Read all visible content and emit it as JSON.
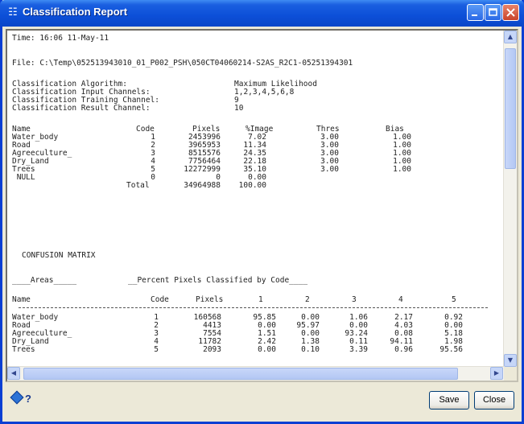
{
  "window": {
    "title": "Classification Report",
    "icon": "report-app-icon",
    "controls": [
      "minimize-icon",
      "maximize-icon",
      "close-icon"
    ]
  },
  "report": {
    "time_line": "Time: 16:06 11-May-11",
    "file_line": "File: C:\\Temp\\052513943010_01_P002_PSH\\050CT04060214-S2AS_R2C1-05251394301",
    "info": [
      {
        "label": "Classification Algorithm:",
        "value": "Maximum Likelihood"
      },
      {
        "label": "Classification Input Channels:",
        "value": "1,2,3,4,5,6,8"
      },
      {
        "label": "Classification Training Channel:",
        "value": "9"
      },
      {
        "label": "Classification Result Channel:",
        "value": "10"
      }
    ],
    "summary_headers": [
      "Name",
      "Code",
      "Pixels",
      "%Image",
      "Thres",
      "Bias"
    ],
    "summary_rows": [
      [
        "Water_body",
        "1",
        "2453996",
        "7.02",
        "3.00",
        "1.00"
      ],
      [
        "Road",
        "2",
        "3965953",
        "11.34",
        "3.00",
        "1.00"
      ],
      [
        "Agreeculture_",
        "3",
        "8515576",
        "24.35",
        "3.00",
        "1.00"
      ],
      [
        "Dry_Land",
        "4",
        "7756464",
        "22.18",
        "3.00",
        "1.00"
      ],
      [
        "Trees",
        "5",
        "12272999",
        "35.10",
        "3.00",
        "1.00"
      ],
      [
        " NULL",
        "0",
        "0",
        "0.00",
        "",
        ""
      ]
    ],
    "total": {
      "label": "Total",
      "pixels": "34964988",
      "percent": "100.00"
    },
    "confusion_title": "CONFUSION MATRIX",
    "areas_label": "____Areas_____",
    "percent_label": "__Percent Pixels Classified by Code____",
    "matrix_headers": [
      "Name",
      "Code",
      "Pixels",
      "1",
      "2",
      "3",
      "4",
      "5"
    ],
    "matrix_rows": [
      [
        "Water_body",
        "1",
        "160568",
        "95.85",
        "0.00",
        "1.06",
        "2.17",
        "0.92"
      ],
      [
        "Road",
        "2",
        "4413",
        "0.00",
        "95.97",
        "0.00",
        "4.03",
        "0.00"
      ],
      [
        "Agreeculture_",
        "3",
        "7554",
        "1.51",
        "0.00",
        "93.24",
        "0.08",
        "5.18"
      ],
      [
        "Dry_Land",
        "4",
        "11782",
        "2.42",
        "1.38",
        "0.11",
        "94.11",
        "1.98"
      ],
      [
        "Trees",
        "5",
        "2093",
        "0.00",
        "0.10",
        "3.39",
        "0.96",
        "95.56"
      ]
    ]
  },
  "buttons": {
    "help_label": "?",
    "save": "Save",
    "close": "Close"
  },
  "colors": {
    "titlebar": "#0c4fd8",
    "window_bg": "#ece9d8"
  }
}
